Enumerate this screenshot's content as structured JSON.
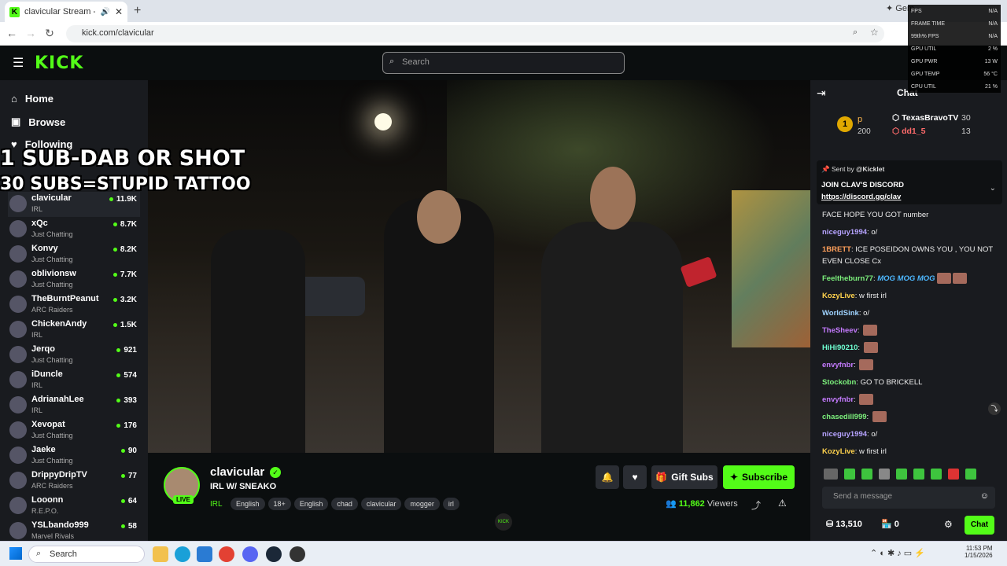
{
  "browser": {
    "tab_title": "clavicular Stream - Watch L",
    "url": "kick.com/clavicular",
    "gemini": "Gem"
  },
  "header": {
    "logo": "KICK",
    "search_placeholder": "Search"
  },
  "sidebar": {
    "nav": [
      {
        "label": "Home"
      },
      {
        "label": "Browse"
      },
      {
        "label": "Following"
      }
    ],
    "channels": [
      {
        "name": "clavicular",
        "category": "IRL",
        "viewers": "11.9K"
      },
      {
        "name": "xQc",
        "category": "Just Chatting",
        "viewers": "8.7K"
      },
      {
        "name": "Konvy",
        "category": "Just Chatting",
        "viewers": "8.2K"
      },
      {
        "name": "oblivionsw",
        "category": "Just Chatting",
        "viewers": "7.7K"
      },
      {
        "name": "TheBurntPeanut",
        "category": "ARC Raiders",
        "viewers": "3.2K"
      },
      {
        "name": "ChickenAndy",
        "category": "IRL",
        "viewers": "1.5K"
      },
      {
        "name": "Jerqo",
        "category": "Just Chatting",
        "viewers": "921"
      },
      {
        "name": "iDuncle",
        "category": "IRL",
        "viewers": "574"
      },
      {
        "name": "AdrianahLee",
        "category": "IRL",
        "viewers": "393"
      },
      {
        "name": "Xevopat",
        "category": "Just Chatting",
        "viewers": "176"
      },
      {
        "name": "Jaeke",
        "category": "Just Chatting",
        "viewers": "90"
      },
      {
        "name": "DrippyDripTV",
        "category": "ARC Raiders",
        "viewers": "77"
      },
      {
        "name": "Looonn",
        "category": "R.E.P.O.",
        "viewers": "64"
      },
      {
        "name": "YSLbando999",
        "category": "Marvel Rivals",
        "viewers": "58"
      }
    ]
  },
  "overlay": {
    "line1": "1 SUB-DAB OR SHOT",
    "line2": "30 SUBS=STUPID TATTOO"
  },
  "stream": {
    "channel": "clavicular",
    "title": "IRL W/ SNEAKO",
    "live_badge": "LIVE",
    "category": "IRL",
    "tags": [
      "English",
      "18+",
      "English",
      "chad",
      "clavicular",
      "mogger",
      "irl"
    ],
    "viewers": "11,862",
    "viewers_label": "Viewers",
    "gift_label": "Gift Subs",
    "subscribe_label": "Subscribe",
    "kick_small": "KICK"
  },
  "chat": {
    "title": "Chat",
    "leaderboard": {
      "rank": "1",
      "p_label": "p",
      "p_count": "200",
      "entries": [
        {
          "name": "TexasBravoTV",
          "count": "30"
        },
        {
          "name": "dd1_5",
          "count": "13"
        }
      ]
    },
    "pinned": {
      "sent_by": "Sent by",
      "sender": "@Kicklet",
      "line1": "JOIN CLAV'S DISCORD",
      "link": "https://discord.gg/clav"
    },
    "messages": [
      {
        "user": "",
        "text": "FACE HOPE YOU GOT number",
        "color": "#eeeeee"
      },
      {
        "user": "niceguy1994",
        "text": "o/",
        "color": "#b6a3ff"
      },
      {
        "user": "1BRETT",
        "text": "ICE POSEIDON OWNS YOU , YOU NOT EVEN CLOSE Cx",
        "color": "#ff9f5a"
      },
      {
        "user": "Feeltheburn77",
        "text": "MOG MOG MOG",
        "color": "#7cf07c"
      },
      {
        "user": "KozyLive",
        "text": "w first irl",
        "color": "#ffd24d"
      },
      {
        "user": "WorldSink",
        "text": "o/",
        "color": "#9fd3ff"
      },
      {
        "user": "TheSheev",
        "text": "",
        "color": "#c57bff"
      },
      {
        "user": "HiHi90210",
        "text": "",
        "color": "#6fffd2"
      },
      {
        "user": "envyfnbr",
        "text": "",
        "color": "#c57bff"
      },
      {
        "user": "Stockobn",
        "text": "GO TO BRICKELL",
        "color": "#7cf07c"
      },
      {
        "user": "envyfnbr",
        "text": "",
        "color": "#c57bff"
      },
      {
        "user": "chasedill999",
        "text": "",
        "color": "#7cf07c"
      },
      {
        "user": "niceguy1994",
        "text": "o/",
        "color": "#b6a3ff"
      },
      {
        "user": "KozyLive",
        "text": "w first irl",
        "color": "#ffd24d"
      }
    ],
    "input_placeholder": "Send a message",
    "points": "13,510",
    "store_count": "0",
    "send_label": "Chat"
  },
  "fps_overlay": {
    "rows": [
      {
        "label": "FPS",
        "value": "N/A"
      },
      {
        "label": "FRAME TIME",
        "value": "N/A"
      },
      {
        "label": "99th% FPS",
        "value": "N/A"
      },
      {
        "label": "GPU UTIL",
        "value": "2 %"
      },
      {
        "label": "GPU PWR",
        "value": "13 W"
      },
      {
        "label": "GPU TEMP",
        "value": "56 °C"
      },
      {
        "label": "CPU UTIL",
        "value": "21 %"
      }
    ]
  },
  "taskbar": {
    "search": "Search",
    "time": "11:53 PM",
    "date": "1/15/2026"
  }
}
